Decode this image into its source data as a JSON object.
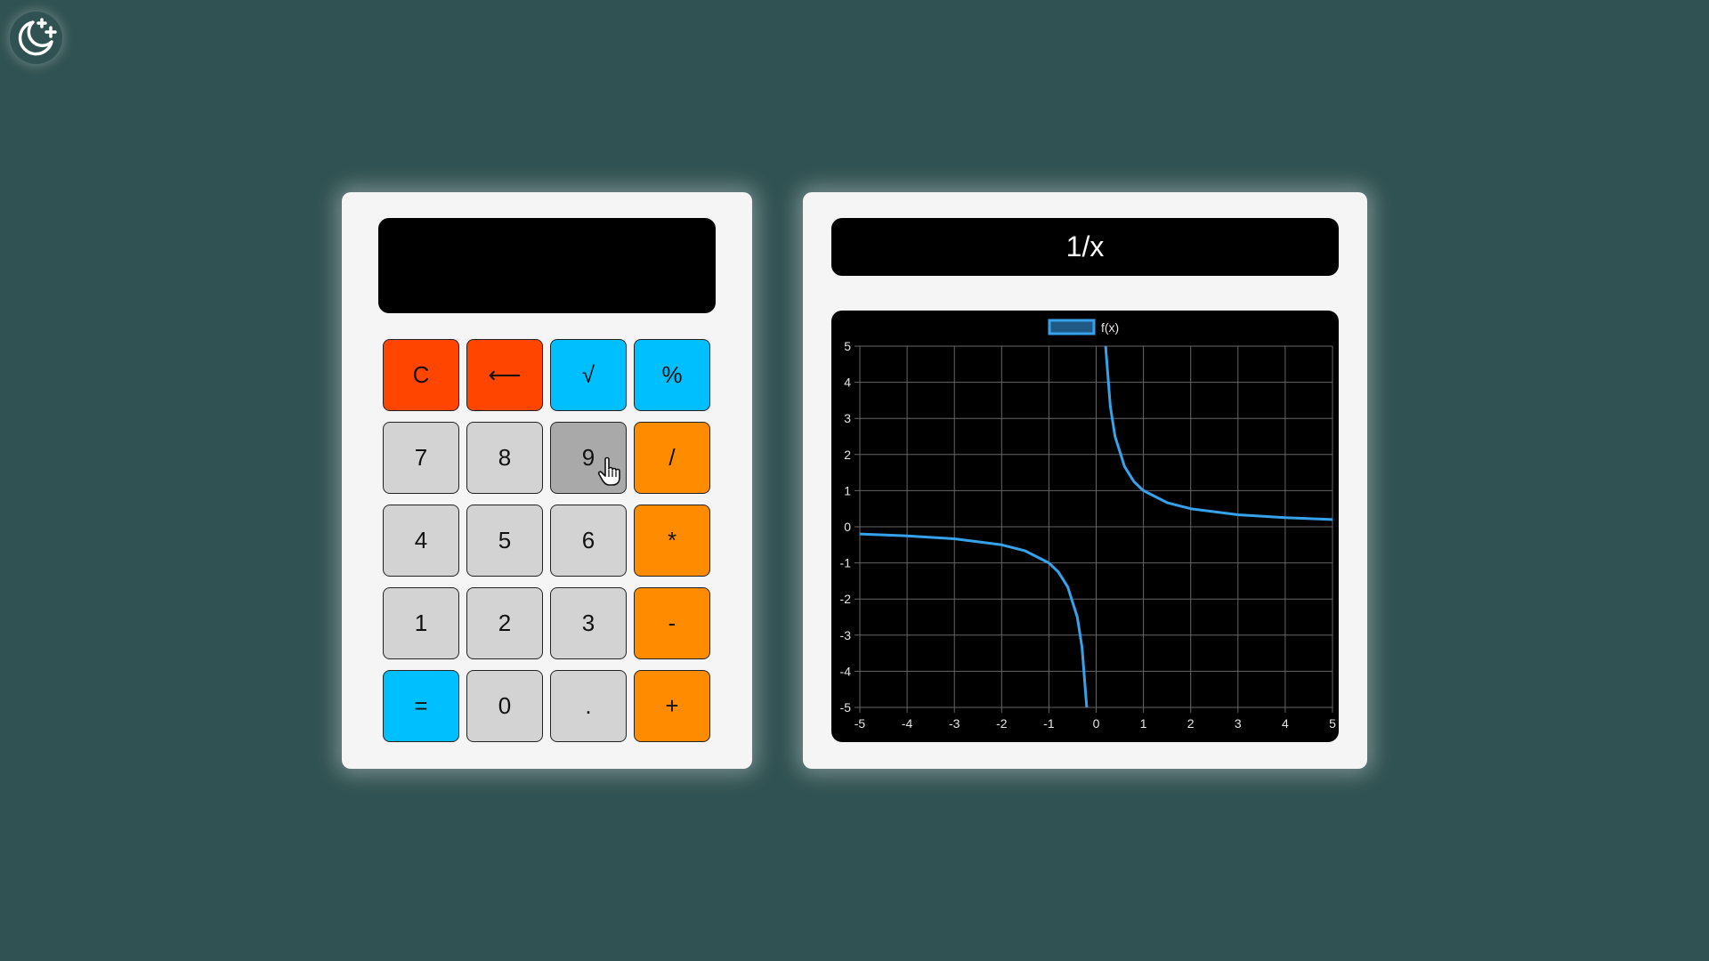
{
  "theme_toggle": {
    "icon": "moon-plus-icon"
  },
  "calculator": {
    "display_value": "",
    "keys": [
      {
        "label": "C",
        "color": "red",
        "name": "clear-button"
      },
      {
        "label": "⟵",
        "color": "red",
        "name": "backspace-button"
      },
      {
        "label": "√",
        "color": "blue",
        "name": "sqrt-button"
      },
      {
        "label": "%",
        "color": "blue",
        "name": "percent-button"
      },
      {
        "label": "7",
        "color": "gray",
        "name": "key-7-button"
      },
      {
        "label": "8",
        "color": "gray",
        "name": "key-8-button"
      },
      {
        "label": "9",
        "color": "hover",
        "name": "key-9-button"
      },
      {
        "label": "/",
        "color": "orange",
        "name": "divide-button"
      },
      {
        "label": "4",
        "color": "gray",
        "name": "key-4-button"
      },
      {
        "label": "5",
        "color": "gray",
        "name": "key-5-button"
      },
      {
        "label": "6",
        "color": "gray",
        "name": "key-6-button"
      },
      {
        "label": "*",
        "color": "orange",
        "name": "multiply-button"
      },
      {
        "label": "1",
        "color": "gray",
        "name": "key-1-button"
      },
      {
        "label": "2",
        "color": "gray",
        "name": "key-2-button"
      },
      {
        "label": "3",
        "color": "gray",
        "name": "key-3-button"
      },
      {
        "label": "-",
        "color": "orange",
        "name": "subtract-button"
      },
      {
        "label": "=",
        "color": "blue",
        "name": "equals-button"
      },
      {
        "label": "0",
        "color": "gray",
        "name": "key-0-button"
      },
      {
        "label": ".",
        "color": "gray",
        "name": "decimal-button"
      },
      {
        "label": "+",
        "color": "orange",
        "name": "add-button"
      }
    ]
  },
  "graph": {
    "function_label": "1/x"
  },
  "colors": {
    "background": "#315252",
    "card": "#f5f5f5",
    "key_red": "#ff4500",
    "key_blue": "#00bfff",
    "key_orange": "#ff8c00",
    "key_gray": "#d3d3d3",
    "key_hover": "#a9a9a9",
    "line": "#36a2eb"
  },
  "chart_data": {
    "type": "line",
    "title": "",
    "xlabel": "",
    "ylabel": "",
    "xlim": [
      -5,
      5
    ],
    "ylim": [
      -5,
      5
    ],
    "x_ticks": [
      "-5",
      "-4",
      "-3",
      "-2",
      "-1",
      "0",
      "1",
      "2",
      "3",
      "4",
      "5"
    ],
    "y_ticks": [
      "5",
      "4",
      "3",
      "2",
      "1",
      "0",
      "-1",
      "-2",
      "-3",
      "-4",
      "-5"
    ],
    "grid": true,
    "legend_position": "top-center",
    "series": [
      {
        "name": "f(x)",
        "color": "#36a2eb",
        "x": [
          -5,
          -4,
          -3,
          -2,
          -1.5,
          -1,
          -0.8,
          -0.6,
          -0.4,
          -0.3,
          -0.2,
          0.2,
          0.3,
          0.4,
          0.6,
          0.8,
          1,
          1.5,
          2,
          3,
          4,
          5
        ],
        "y": [
          -0.2,
          -0.25,
          -0.333,
          -0.5,
          -0.667,
          -1,
          -1.25,
          -1.667,
          -2.5,
          -3.333,
          -5,
          5,
          3.333,
          2.5,
          1.667,
          1.25,
          1,
          0.667,
          0.5,
          0.333,
          0.25,
          0.2
        ]
      }
    ]
  }
}
